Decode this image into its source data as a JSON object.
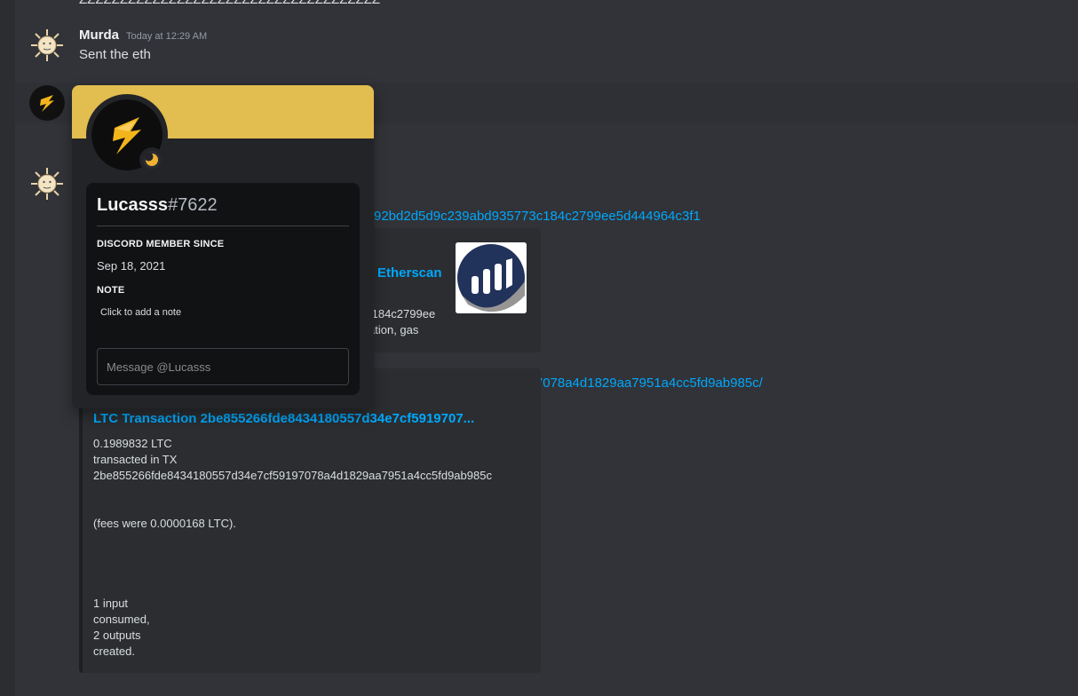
{
  "top_cut_text": "ZZZZZZZZZZZZZZZZZZZZZZZZZZZZZZZZZZZZZ",
  "messages": [
    {
      "username": "Murda",
      "timestamp": "Today at 12:29 AM",
      "text": "Sent the eth"
    }
  ],
  "second_message": {
    "link_text": "92bd2d5d9c239abd935773c184c2799ee5d444964c3f1",
    "embed1": {
      "title": "Etherscan",
      "desc_line1": ":184c2799ee",
      "desc_line2": "ation, gas"
    },
    "link2_text": "le8434180557d34e7cf59197078a4d1829aa7951a4cc5fd9ab985c/",
    "embed2": {
      "title": "LTC Transaction 2be855266fde8434180557d34e7cf5919707...",
      "amount": "0.1989832 LTC",
      "transacted": "transacted in TX",
      "tx_hash": "2be855266fde8434180557d34e7cf59197078a4d1829aa7951a4cc5fd9ab985c",
      "fees": "(fees were 0.0000168 LTC).",
      "inputs_line1": "1 input",
      "inputs_line2": "consumed,",
      "outputs_line1": "2 outputs",
      "outputs_line2": "created."
    }
  },
  "profile_popout": {
    "name": "Lucasss",
    "discriminator": "#7622",
    "member_since_heading": "DISCORD MEMBER SINCE",
    "member_since_value": "Sep 18, 2021",
    "note_heading": "NOTE",
    "note_placeholder": "Click to add a note",
    "message_placeholder": "Message @Lucasss",
    "banner_color": "#e2bd4f",
    "status": "idle-moon-icon"
  },
  "colors": {
    "background": "#313338",
    "link": "#00a8fc",
    "embed_bg": "#2b2d31"
  }
}
